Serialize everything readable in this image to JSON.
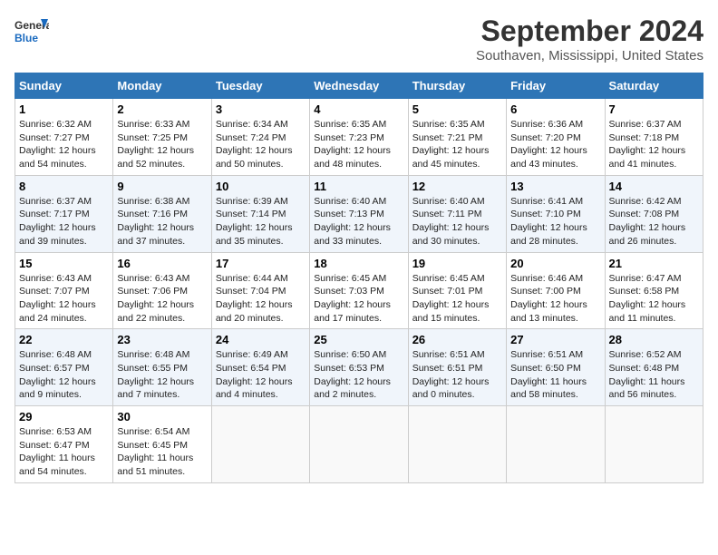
{
  "header": {
    "logo_line1": "General",
    "logo_line2": "Blue",
    "main_title": "September 2024",
    "subtitle": "Southaven, Mississippi, United States"
  },
  "calendar": {
    "days_of_week": [
      "Sunday",
      "Monday",
      "Tuesday",
      "Wednesday",
      "Thursday",
      "Friday",
      "Saturday"
    ],
    "weeks": [
      [
        {
          "day": "1",
          "sunrise": "6:32 AM",
          "sunset": "7:27 PM",
          "daylight": "12 hours and 54 minutes."
        },
        {
          "day": "2",
          "sunrise": "6:33 AM",
          "sunset": "7:25 PM",
          "daylight": "12 hours and 52 minutes."
        },
        {
          "day": "3",
          "sunrise": "6:34 AM",
          "sunset": "7:24 PM",
          "daylight": "12 hours and 50 minutes."
        },
        {
          "day": "4",
          "sunrise": "6:35 AM",
          "sunset": "7:23 PM",
          "daylight": "12 hours and 48 minutes."
        },
        {
          "day": "5",
          "sunrise": "6:35 AM",
          "sunset": "7:21 PM",
          "daylight": "12 hours and 45 minutes."
        },
        {
          "day": "6",
          "sunrise": "6:36 AM",
          "sunset": "7:20 PM",
          "daylight": "12 hours and 43 minutes."
        },
        {
          "day": "7",
          "sunrise": "6:37 AM",
          "sunset": "7:18 PM",
          "daylight": "12 hours and 41 minutes."
        }
      ],
      [
        {
          "day": "8",
          "sunrise": "6:37 AM",
          "sunset": "7:17 PM",
          "daylight": "12 hours and 39 minutes."
        },
        {
          "day": "9",
          "sunrise": "6:38 AM",
          "sunset": "7:16 PM",
          "daylight": "12 hours and 37 minutes."
        },
        {
          "day": "10",
          "sunrise": "6:39 AM",
          "sunset": "7:14 PM",
          "daylight": "12 hours and 35 minutes."
        },
        {
          "day": "11",
          "sunrise": "6:40 AM",
          "sunset": "7:13 PM",
          "daylight": "12 hours and 33 minutes."
        },
        {
          "day": "12",
          "sunrise": "6:40 AM",
          "sunset": "7:11 PM",
          "daylight": "12 hours and 30 minutes."
        },
        {
          "day": "13",
          "sunrise": "6:41 AM",
          "sunset": "7:10 PM",
          "daylight": "12 hours and 28 minutes."
        },
        {
          "day": "14",
          "sunrise": "6:42 AM",
          "sunset": "7:08 PM",
          "daylight": "12 hours and 26 minutes."
        }
      ],
      [
        {
          "day": "15",
          "sunrise": "6:43 AM",
          "sunset": "7:07 PM",
          "daylight": "12 hours and 24 minutes."
        },
        {
          "day": "16",
          "sunrise": "6:43 AM",
          "sunset": "7:06 PM",
          "daylight": "12 hours and 22 minutes."
        },
        {
          "day": "17",
          "sunrise": "6:44 AM",
          "sunset": "7:04 PM",
          "daylight": "12 hours and 20 minutes."
        },
        {
          "day": "18",
          "sunrise": "6:45 AM",
          "sunset": "7:03 PM",
          "daylight": "12 hours and 17 minutes."
        },
        {
          "day": "19",
          "sunrise": "6:45 AM",
          "sunset": "7:01 PM",
          "daylight": "12 hours and 15 minutes."
        },
        {
          "day": "20",
          "sunrise": "6:46 AM",
          "sunset": "7:00 PM",
          "daylight": "12 hours and 13 minutes."
        },
        {
          "day": "21",
          "sunrise": "6:47 AM",
          "sunset": "6:58 PM",
          "daylight": "12 hours and 11 minutes."
        }
      ],
      [
        {
          "day": "22",
          "sunrise": "6:48 AM",
          "sunset": "6:57 PM",
          "daylight": "12 hours and 9 minutes."
        },
        {
          "day": "23",
          "sunrise": "6:48 AM",
          "sunset": "6:55 PM",
          "daylight": "12 hours and 7 minutes."
        },
        {
          "day": "24",
          "sunrise": "6:49 AM",
          "sunset": "6:54 PM",
          "daylight": "12 hours and 4 minutes."
        },
        {
          "day": "25",
          "sunrise": "6:50 AM",
          "sunset": "6:53 PM",
          "daylight": "12 hours and 2 minutes."
        },
        {
          "day": "26",
          "sunrise": "6:51 AM",
          "sunset": "6:51 PM",
          "daylight": "12 hours and 0 minutes."
        },
        {
          "day": "27",
          "sunrise": "6:51 AM",
          "sunset": "6:50 PM",
          "daylight": "11 hours and 58 minutes."
        },
        {
          "day": "28",
          "sunrise": "6:52 AM",
          "sunset": "6:48 PM",
          "daylight": "11 hours and 56 minutes."
        }
      ],
      [
        {
          "day": "29",
          "sunrise": "6:53 AM",
          "sunset": "6:47 PM",
          "daylight": "11 hours and 54 minutes."
        },
        {
          "day": "30",
          "sunrise": "6:54 AM",
          "sunset": "6:45 PM",
          "daylight": "11 hours and 51 minutes."
        },
        null,
        null,
        null,
        null,
        null
      ]
    ]
  }
}
